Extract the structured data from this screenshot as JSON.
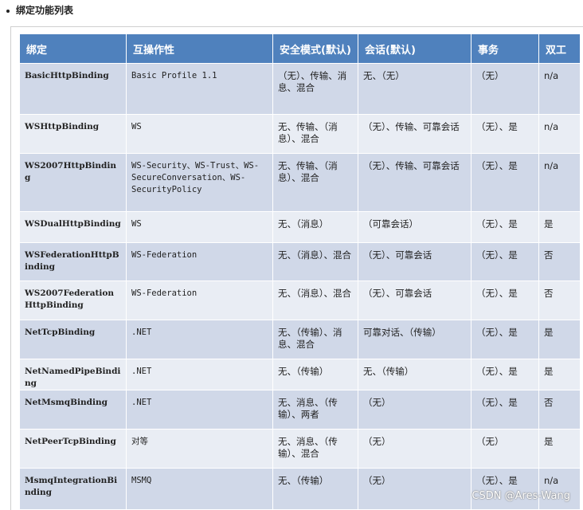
{
  "heading": "绑定功能列表",
  "table": {
    "headers": [
      "绑定",
      "互操作性",
      "安全模式(默认)",
      "会话(默认)",
      "事务",
      "双工"
    ],
    "rows": [
      [
        "BasicHttpBinding",
        "Basic Profile 1.1",
        "（无）、传输、消息、混合",
        "无、（无）",
        "（无）",
        "n/a"
      ],
      [
        "WSHttpBinding",
        "WS",
        "无、传输、（消息）、混合",
        "（无）、传输、可靠会话",
        "（无）、是",
        "n/a"
      ],
      [
        "WS2007HttpBinding",
        "WS-Security、WS-Trust、WS-SecureConversation、WS-SecurityPolicy",
        "无、传输、（消息）、混合",
        "（无）、传输、可靠会话",
        "（无）、是",
        "n/a"
      ],
      [
        "WSDualHttpBinding",
        "WS",
        "无、（消息）",
        "（可靠会话）",
        "（无）、是",
        "是"
      ],
      [
        "WSFederationHttpBinding",
        "WS-Federation",
        "无、（消息）、混合",
        "（无）、可靠会话",
        "（无）、是",
        "否"
      ],
      [
        "WS2007FederationHttpBinding",
        "WS-Federation",
        "无、（消息）、混合",
        "（无）、可靠会话",
        "（无）、是",
        "否"
      ],
      [
        "NetTcpBinding",
        ".NET",
        "无、（传输）、消息、混合",
        "可靠对话、（传输）",
        "（无）、是",
        "是"
      ],
      [
        "NetNamedPipeBinding",
        ".NET",
        "无、（传输）",
        "无、（传输）",
        "（无）、是",
        "是"
      ],
      [
        "NetMsmqBinding",
        ".NET",
        "无、消息、（传输）、两者",
        "（无）",
        "（无）、是",
        "否"
      ],
      [
        "NetPeerTcpBinding",
        "对等",
        "无、消息、（传输）、混合",
        "（无）",
        "（无）",
        "是"
      ],
      [
        "MsmqIntegrationBinding",
        "MSMQ",
        "无、（传输）",
        "（无）",
        "（无）、是",
        "n/a"
      ]
    ]
  },
  "watermark": "CSDN @Ares-Wang"
}
